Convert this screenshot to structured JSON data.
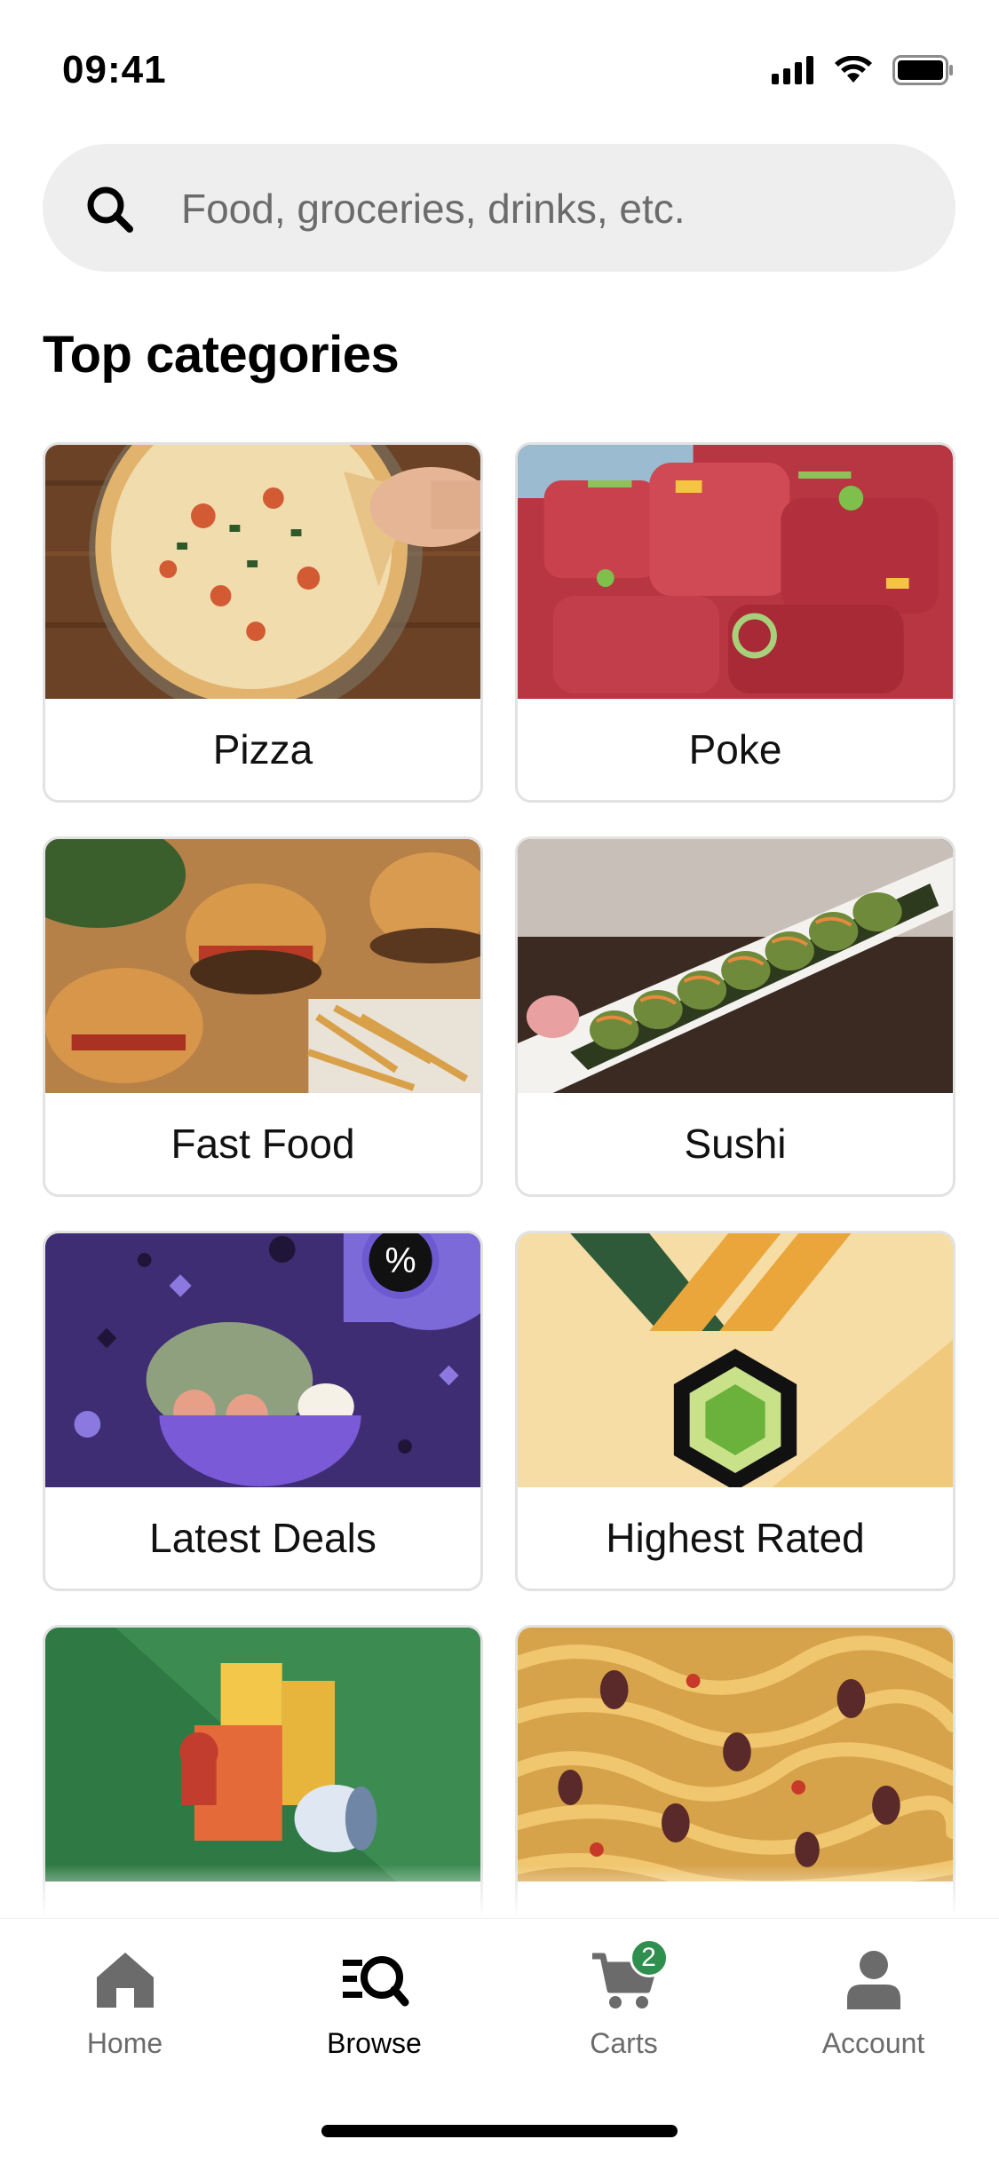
{
  "status": {
    "time": "09:41",
    "icons": [
      "cellular-signal-icon",
      "wifi-icon",
      "battery-icon"
    ]
  },
  "search": {
    "placeholder": "Food, groceries, drinks, etc.",
    "icon": "search-icon"
  },
  "section": {
    "title": "Top categories"
  },
  "categories": [
    {
      "label": "Pizza"
    },
    {
      "label": "Poke"
    },
    {
      "label": "Fast Food"
    },
    {
      "label": "Sushi"
    },
    {
      "label": "Latest Deals"
    },
    {
      "label": "Highest Rated"
    },
    {
      "label": ""
    },
    {
      "label": ""
    }
  ],
  "tabs": [
    {
      "label": "Home",
      "icon": "home-icon",
      "active": false
    },
    {
      "label": "Browse",
      "icon": "browse-icon",
      "active": true
    },
    {
      "label": "Carts",
      "icon": "cart-icon",
      "active": false,
      "badge": "2"
    },
    {
      "label": "Account",
      "icon": "account-icon",
      "active": false
    }
  ],
  "colors": {
    "search_bg": "#eeeeee",
    "card_border": "#e2e2e2",
    "badge": "#2f8f4e",
    "deals_bg": "#3f2d73",
    "rated_bg": "#f6dca5",
    "grocery_bg": "#2f7a44"
  }
}
